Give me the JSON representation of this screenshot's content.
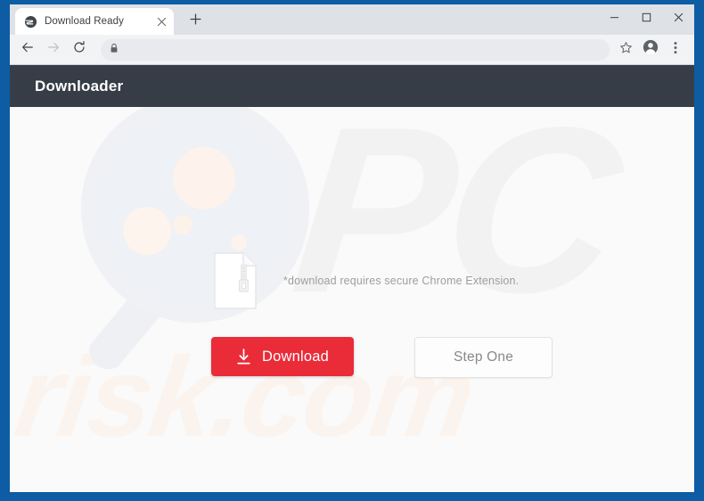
{
  "browser": {
    "tab": {
      "title": "Download Ready",
      "favicon_icon": "globe-icon",
      "close_icon": "close-icon"
    },
    "new_tab_icon": "plus-icon",
    "window_controls": {
      "minimize_icon": "minimize-icon",
      "maximize_icon": "maximize-icon",
      "close_icon": "close-icon"
    },
    "toolbar": {
      "back_icon": "back-arrow-icon",
      "forward_icon": "forward-arrow-icon",
      "reload_icon": "reload-icon",
      "lock_icon": "lock-icon",
      "url": "",
      "url_placeholder": "",
      "bookmark_icon": "star-icon",
      "profile_icon": "account-avatar-icon",
      "menu_icon": "three-dot-menu-icon"
    }
  },
  "page": {
    "header": {
      "title": "Downloader"
    },
    "file": {
      "icon": "zip-file-icon"
    },
    "notice": "*download requires secure Chrome Extension.",
    "buttons": {
      "download": {
        "label": "Download",
        "icon": "download-arrow-icon"
      },
      "step_one": {
        "label": "Step One"
      }
    },
    "watermarks": {
      "logo": "PC",
      "domain": "risk.com"
    },
    "illustration": "magnifying-glass-illustration"
  },
  "colors": {
    "frame_blue": "#0d5ca4",
    "header_dark": "#363d47",
    "download_red": "#ea2b38",
    "page_background": "#fafafa",
    "notice_gray": "#9e9e9e",
    "tabstrip_gray": "#dee1e6",
    "toolbar_gray": "#f1f3f4",
    "watermark_pc": "#f2f2f2",
    "watermark_domain": "#fbf4ee"
  }
}
